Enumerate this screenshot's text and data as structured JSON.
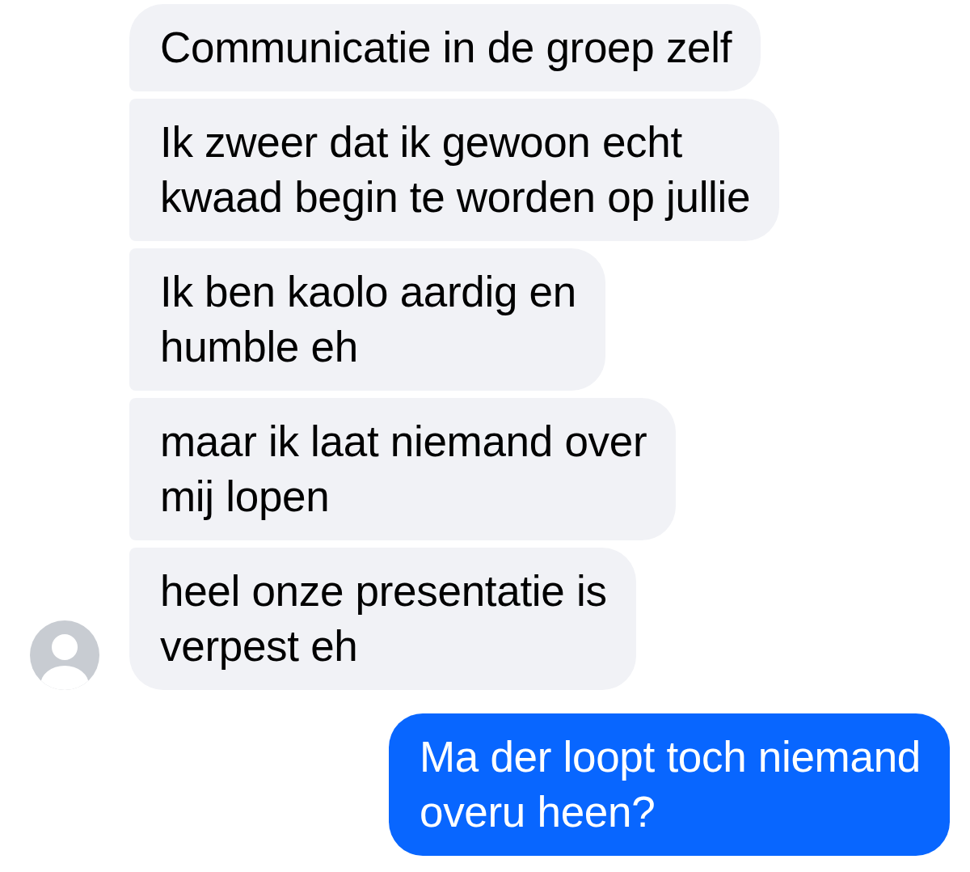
{
  "messages": [
    {
      "kind": "received",
      "text": "Communicatie in de groep zelf",
      "avatar": false
    },
    {
      "kind": "received",
      "text": "Ik zweer dat ik gewoon echt\nkwaad begin te worden op jullie",
      "avatar": false
    },
    {
      "kind": "received",
      "text": "Ik ben kaolo aardig en\nhumble eh",
      "avatar": false
    },
    {
      "kind": "received",
      "text": "maar ik laat niemand over\nmij lopen",
      "avatar": false
    },
    {
      "kind": "received",
      "text": "heel onze presentatie is\nverpest eh",
      "avatar": true
    },
    {
      "kind": "sent",
      "text": "Ma der loopt toch niemand\noveru heen?",
      "avatar": false
    }
  ]
}
